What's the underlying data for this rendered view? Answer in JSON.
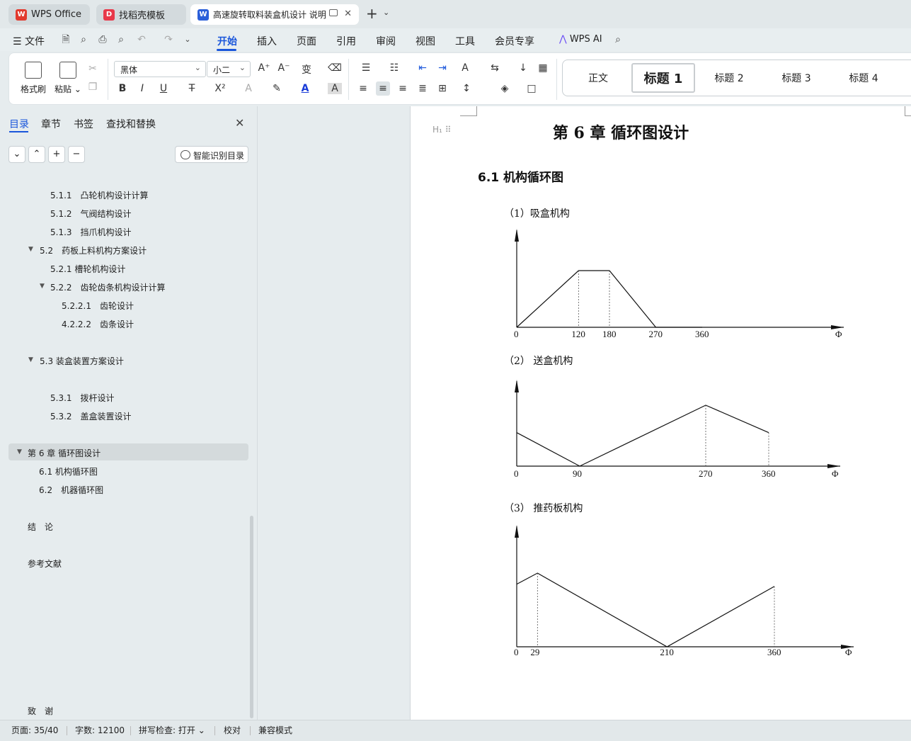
{
  "tabs": [
    {
      "label": "WPS Office",
      "icon": "wps-logo-icon"
    },
    {
      "label": "找稻壳模板",
      "icon": "docer-icon"
    },
    {
      "label": "高速旋转取料装盒机设计 说明",
      "icon": "word-doc-icon"
    }
  ],
  "menu": {
    "file": "文件",
    "items": [
      "开始",
      "插入",
      "页面",
      "引用",
      "审阅",
      "视图",
      "工具",
      "会员专享"
    ],
    "wps_ai": "WPS AI"
  },
  "ribbon": {
    "format_painter": "格式刷",
    "paste": "粘贴",
    "font_name": "黑体",
    "font_size": "小二",
    "styles": [
      "正文",
      "标题 1",
      "标题 2",
      "标题 3",
      "标题 4"
    ]
  },
  "nav": {
    "tabs": [
      "目录",
      "章节",
      "书签",
      "查找和替换"
    ],
    "ai_toc": "智能识别目录",
    "toc": [
      {
        "label": "5.1.1　凸轮机构设计计算"
      },
      {
        "label": "5.1.2　气阀结构设计"
      },
      {
        "label": "5.1.3　挡爪机构设计"
      },
      {
        "label": "5.2　药板上料机构方案设计"
      },
      {
        "label": "5.2.1  槽轮机构设计"
      },
      {
        "label": "5.2.2　齿轮齿条机构设计计算"
      },
      {
        "label": "5.2.2.1　齿轮设计"
      },
      {
        "label": "4.2.2.2　齿条设计"
      },
      {
        "label": "5.3  装盒装置方案设计"
      },
      {
        "label": "5.3.1　拨杆设计"
      },
      {
        "label": "5.3.2　盖盒装置设计"
      },
      {
        "label": "第 6 章  循环图设计"
      },
      {
        "label": "6.1  机构循环图"
      },
      {
        "label": "6.2　机器循环图"
      },
      {
        "label": "结　论"
      },
      {
        "label": "参考文献"
      },
      {
        "label": "致　谢"
      }
    ]
  },
  "doc": {
    "chapter_title": "第 6 章 循环图设计",
    "section_title": "6.1 机构循环图",
    "subtitles": [
      "（1）吸盒机构",
      "（2）  送盒机构",
      "（3）  推药板机构"
    ],
    "heading_marker": "H₁"
  },
  "chart_data": [
    {
      "type": "line",
      "title": "（1）吸盒机构",
      "xlabel": "Φ",
      "x": [
        0,
        120,
        180,
        270,
        360
      ],
      "y": [
        0,
        1,
        1,
        0,
        0
      ],
      "tick_labels": [
        "0",
        "120",
        "180",
        "270",
        "360"
      ]
    },
    {
      "type": "line",
      "title": "（2）  送盒机构",
      "xlabel": "Φ",
      "x": [
        0,
        90,
        270,
        360
      ],
      "y": [
        0.55,
        0,
        1,
        0.55
      ],
      "tick_labels": [
        "0",
        "90",
        "270",
        "360"
      ]
    },
    {
      "type": "line",
      "title": "（3）  推药板机构",
      "xlabel": "Φ",
      "x": [
        0,
        29,
        210,
        360
      ],
      "y": [
        0.85,
        1,
        0,
        0.82
      ],
      "tick_labels": [
        "0",
        "29",
        "210",
        "360"
      ]
    }
  ],
  "status": {
    "page": "页面: 35/40",
    "words": "字数: 12100",
    "spell": "拼写检查: 打开",
    "proof": "校对",
    "compat": "兼容模式"
  }
}
